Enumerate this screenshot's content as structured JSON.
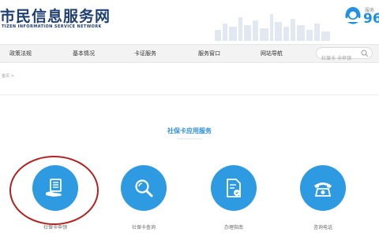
{
  "header": {
    "site_title": "市民信息服务网",
    "site_subtitle": "TIZEN INFORMATION SERVICE NETWORK",
    "hotline_caption": "服务",
    "hotline_number": "96"
  },
  "nav": {
    "items": [
      {
        "label": "政策法规"
      },
      {
        "label": "基本情况"
      },
      {
        "label": "卡证服务"
      },
      {
        "label": "服务窗口"
      },
      {
        "label": "网站导航"
      }
    ]
  },
  "search": {
    "placeholder": "社保卡 卡申领"
  },
  "breadcrumb": "首页 >",
  "section": {
    "title": "社保卡应用服务"
  },
  "services": [
    {
      "label": "社保卡申领",
      "icon": "document-in-hand-icon"
    },
    {
      "label": "社保卡查询",
      "icon": "magnifier-icon"
    },
    {
      "label": "办理指南",
      "icon": "guide-document-icon"
    },
    {
      "label": "咨询电话",
      "icon": "telephone-icon"
    }
  ],
  "colors": {
    "brand": "#1f3f73",
    "accent": "#2d9ae2",
    "highlight_ring": "#b41f1f",
    "nav_background": "#f3f3f3"
  }
}
